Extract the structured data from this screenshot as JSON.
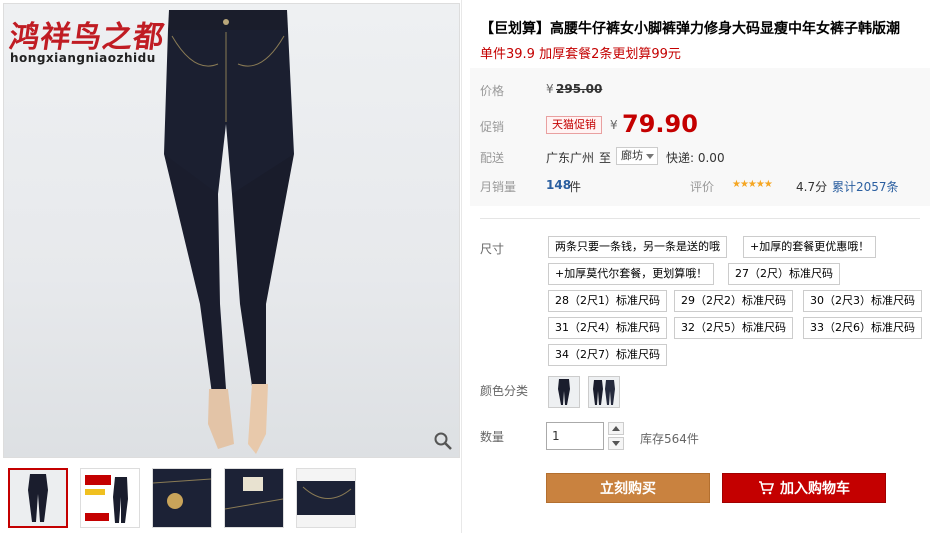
{
  "gallery": {
    "brand_cn": "鸿祥鸟之都",
    "brand_en": "hongxiangniaozhidu",
    "zoom_icon": "magnifier-icon",
    "thumbnails": [
      {
        "name": "thumb-jeans-full"
      },
      {
        "name": "thumb-promo-poster"
      },
      {
        "name": "thumb-button-detail"
      },
      {
        "name": "thumb-label-detail"
      },
      {
        "name": "thumb-pocket-detail"
      }
    ]
  },
  "product": {
    "title": "【巨划算】高腰牛仔裤女小脚裤弹力修身大码显瘦中年女裤子韩版潮",
    "subtitle": "单件39.9 加厚套餐2条更划算99元"
  },
  "meta": {
    "price_label": "价格",
    "price_currency": "¥",
    "price_original": "295.00",
    "promo_label": "促销",
    "promo_badge": "天猫促销",
    "promo_currency": "¥",
    "promo_price": "79.90",
    "ship_label": "配送",
    "ship_from": "广东广州",
    "ship_to_word": "至",
    "ship_dest": "廊坊",
    "ship_fee": "快递: 0.00",
    "sales_label": "月销量",
    "sales_count": "148",
    "sales_unit": "件",
    "rating_label": "评价",
    "rating_score": "4.7分",
    "rating_total": "累计2057条"
  },
  "options": {
    "size_label": "尺寸",
    "sizes": [
      "两条只要一条钱，另一条是送的哦",
      "+加厚的套餐更优惠哦！",
      "+加厚莫代尔套餐，更划算哦！",
      "27（2尺）标准尺码",
      "28（2尺1）标准尺码",
      "29（2尺2）标准尺码",
      "30（2尺3）标准尺码",
      "31（2尺4）标准尺码",
      "32（2尺5）标准尺码",
      "33（2尺6）标准尺码",
      "34（2尺7）标准尺码"
    ],
    "color_label": "颜色分类",
    "qty_label": "数量",
    "qty_value": "1",
    "stock_text": "库存564件"
  },
  "actions": {
    "buy_label": "立刻购买",
    "cart_label": "加入购物车",
    "cart_icon": "shopping-cart-icon"
  },
  "colors": {
    "accent_red": "#c40000",
    "buy_orange": "#c9823f",
    "meta_bg": "#f8f8f8"
  }
}
